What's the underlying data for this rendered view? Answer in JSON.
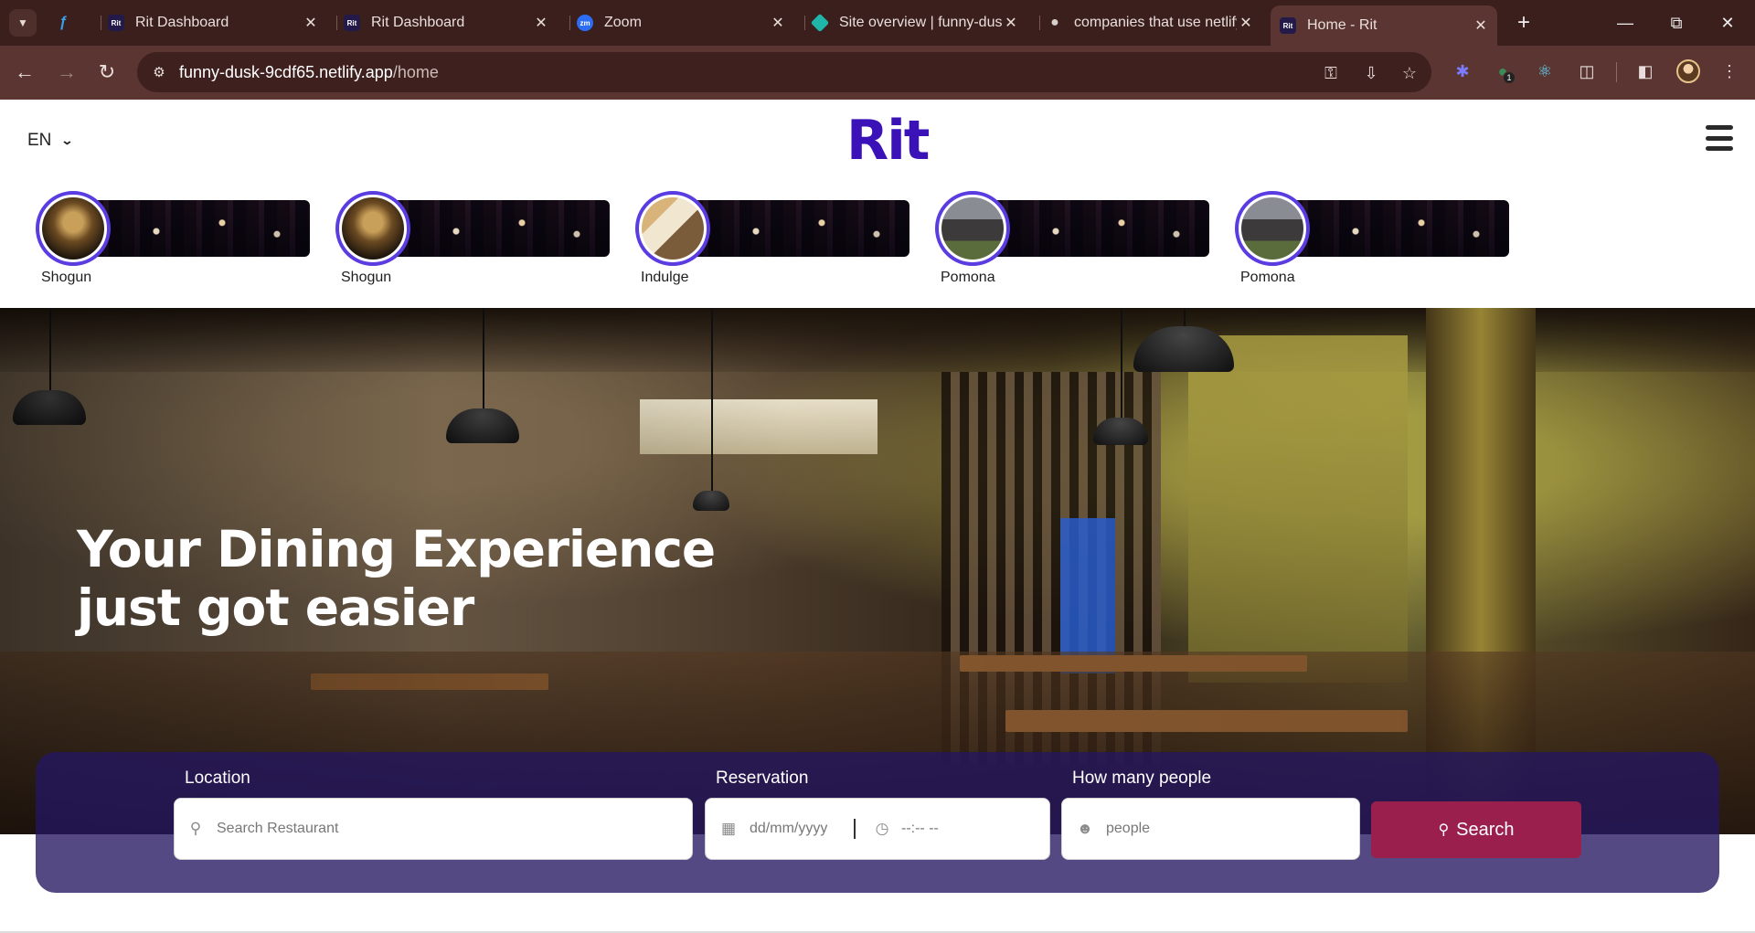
{
  "browser": {
    "tabs": [
      {
        "title": "Rit Dashboard",
        "favicon": "rit-favicon"
      },
      {
        "title": "Rit Dashboard",
        "favicon": "rit-favicon"
      },
      {
        "title": "Zoom",
        "favicon": "zoom-favicon"
      },
      {
        "title": "Site overview | funny-dusk",
        "favicon": "netlify-favicon"
      },
      {
        "title": "companies that use netlify",
        "favicon": "globe-favicon"
      },
      {
        "title": "Home - Rit",
        "favicon": "rit-favicon",
        "active": true
      }
    ],
    "favicon_text": {
      "rit": "Rit",
      "zoom": "zm"
    },
    "url_host": "funny-dusk-9cdf65.netlify.app",
    "url_path": "/home",
    "extension_badge": "1",
    "accent_color": "#5a3531"
  },
  "header": {
    "language": "EN",
    "logo": "Rit"
  },
  "stories": [
    {
      "name": "Shogun",
      "image": "shogun"
    },
    {
      "name": "Shogun",
      "image": "shogun"
    },
    {
      "name": "Indulge",
      "image": "indulge"
    },
    {
      "name": "Pomona",
      "image": "pomona"
    },
    {
      "name": "Pomona",
      "image": "pomona"
    }
  ],
  "hero": {
    "headline_line1": "Your Dining Experience",
    "headline_line2": "just got easier"
  },
  "search": {
    "location_label": "Location",
    "location_placeholder": "Search Restaurant",
    "reservation_label": "Reservation",
    "date_placeholder": "dd/mm/yyyy",
    "time_placeholder": "--:-- --",
    "people_label": "How many people",
    "people_placeholder": "people",
    "button_label": "Search",
    "panel_color": "#241660",
    "button_color": "#9b1f4c"
  },
  "colors": {
    "brand": "#3a12b8",
    "story_ring": "#5a3ce0"
  }
}
